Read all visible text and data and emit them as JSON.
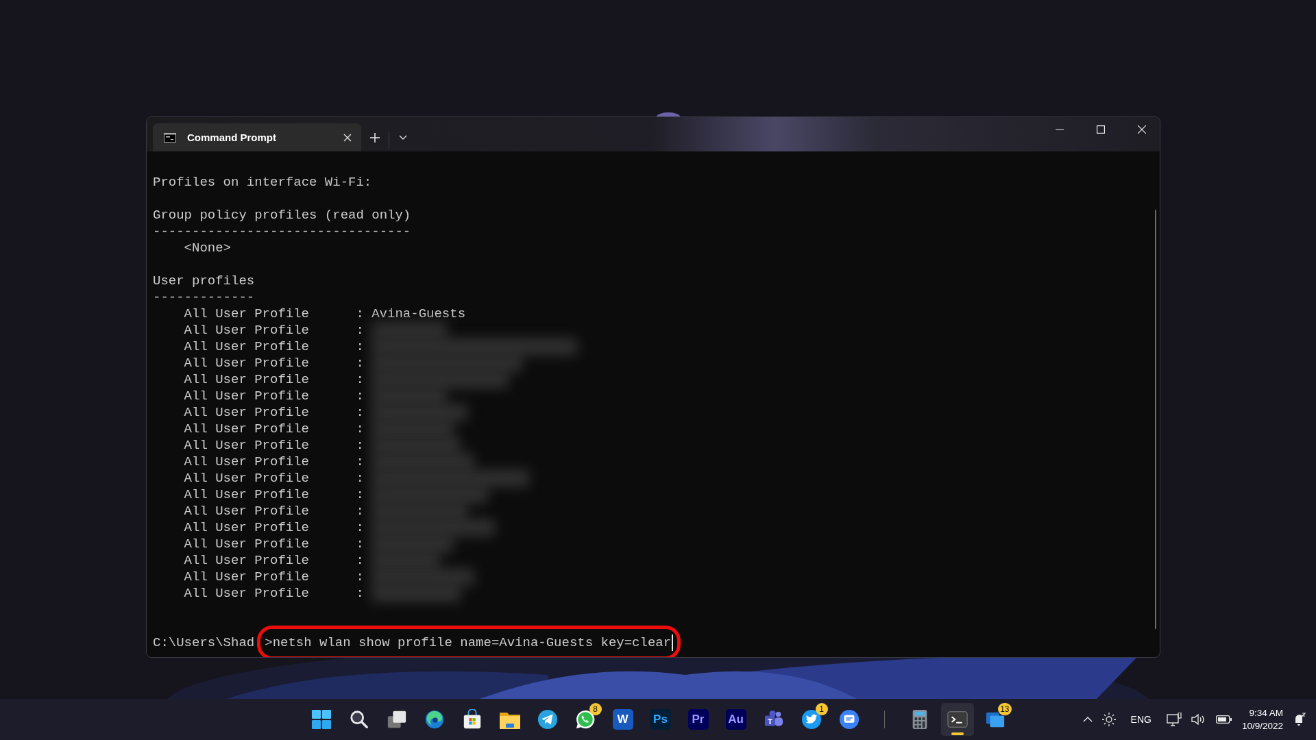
{
  "window": {
    "tab": {
      "title": "Command Prompt",
      "selected": true
    }
  },
  "terminal": {
    "lines": [
      {
        "kind": "text",
        "text": "Profiles on interface Wi-Fi:"
      },
      {
        "kind": "blank"
      },
      {
        "kind": "text",
        "text": "Group policy profiles (read only)"
      },
      {
        "kind": "text",
        "text": "---------------------------------"
      },
      {
        "kind": "indented",
        "text": "<None>"
      },
      {
        "kind": "blank"
      },
      {
        "kind": "text",
        "text": "User profiles"
      },
      {
        "kind": "text",
        "text": "-------------"
      },
      {
        "kind": "profile",
        "label": "All User Profile",
        "separator": ":",
        "value": "Avina-Guests",
        "redacted": false
      },
      {
        "kind": "profile",
        "label": "All User Profile",
        "separator": ":",
        "redacted": true
      },
      {
        "kind": "profile",
        "label": "All User Profile",
        "separator": ":",
        "redacted": true
      },
      {
        "kind": "profile",
        "label": "All User Profile",
        "separator": ":",
        "redacted": true
      },
      {
        "kind": "profile",
        "label": "All User Profile",
        "separator": ":",
        "redacted": true
      },
      {
        "kind": "profile",
        "label": "All User Profile",
        "separator": ":",
        "redacted": true
      },
      {
        "kind": "profile",
        "label": "All User Profile",
        "separator": ":",
        "redacted": true
      },
      {
        "kind": "profile",
        "label": "All User Profile",
        "separator": ":",
        "redacted": true
      },
      {
        "kind": "profile",
        "label": "All User Profile",
        "separator": ":",
        "redacted": true
      },
      {
        "kind": "profile",
        "label": "All User Profile",
        "separator": ":",
        "redacted": true
      },
      {
        "kind": "profile",
        "label": "All User Profile",
        "separator": ":",
        "redacted": true
      },
      {
        "kind": "profile",
        "label": "All User Profile",
        "separator": ":",
        "redacted": true
      },
      {
        "kind": "profile",
        "label": "All User Profile",
        "separator": ":",
        "redacted": true
      },
      {
        "kind": "profile",
        "label": "All User Profile",
        "separator": ":",
        "redacted": true
      },
      {
        "kind": "profile",
        "label": "All User Profile",
        "separator": ":",
        "redacted": true
      },
      {
        "kind": "profile",
        "label": "All User Profile",
        "separator": ":",
        "redacted": true
      },
      {
        "kind": "profile",
        "label": "All User Profile",
        "separator": ":",
        "redacted": true
      },
      {
        "kind": "profile",
        "label": "All User Profile",
        "separator": ":",
        "redacted": true
      },
      {
        "kind": "blank"
      },
      {
        "kind": "blank"
      }
    ],
    "prompt": {
      "path": "C:\\Users\\Shad",
      "command": ">netsh wlan show profile name=Avina-Guests key=clear",
      "highlighted": true
    }
  },
  "taskbar": {
    "apps": [
      {
        "kind": "start",
        "selected": false
      },
      {
        "kind": "search",
        "selected": false
      },
      {
        "kind": "task-view",
        "selected": false
      },
      {
        "kind": "edge",
        "selected": false
      },
      {
        "kind": "store",
        "selected": false
      },
      {
        "kind": "folder",
        "selected": false
      },
      {
        "kind": "telegram",
        "selected": false
      },
      {
        "kind": "whatsapp",
        "selected": false,
        "badge": "8"
      },
      {
        "kind": "word",
        "selected": false,
        "label": "W"
      },
      {
        "kind": "photoshop",
        "selected": false,
        "label": "Ps"
      },
      {
        "kind": "premiere",
        "selected": false,
        "label": "Pr"
      },
      {
        "kind": "audition",
        "selected": false,
        "label": "Au"
      },
      {
        "kind": "teams",
        "selected": false,
        "label": "T"
      },
      {
        "kind": "twitter",
        "selected": false,
        "badge": "1"
      },
      {
        "kind": "messages",
        "selected": false
      },
      {
        "kind": "separator"
      },
      {
        "kind": "calculator",
        "selected": false
      },
      {
        "kind": "terminal",
        "selected": true
      },
      {
        "kind": "todo",
        "selected": false,
        "badge": "13"
      }
    ],
    "tray": {
      "language": "ENG",
      "time": "9:34 AM",
      "date": "10/9/2022"
    }
  }
}
